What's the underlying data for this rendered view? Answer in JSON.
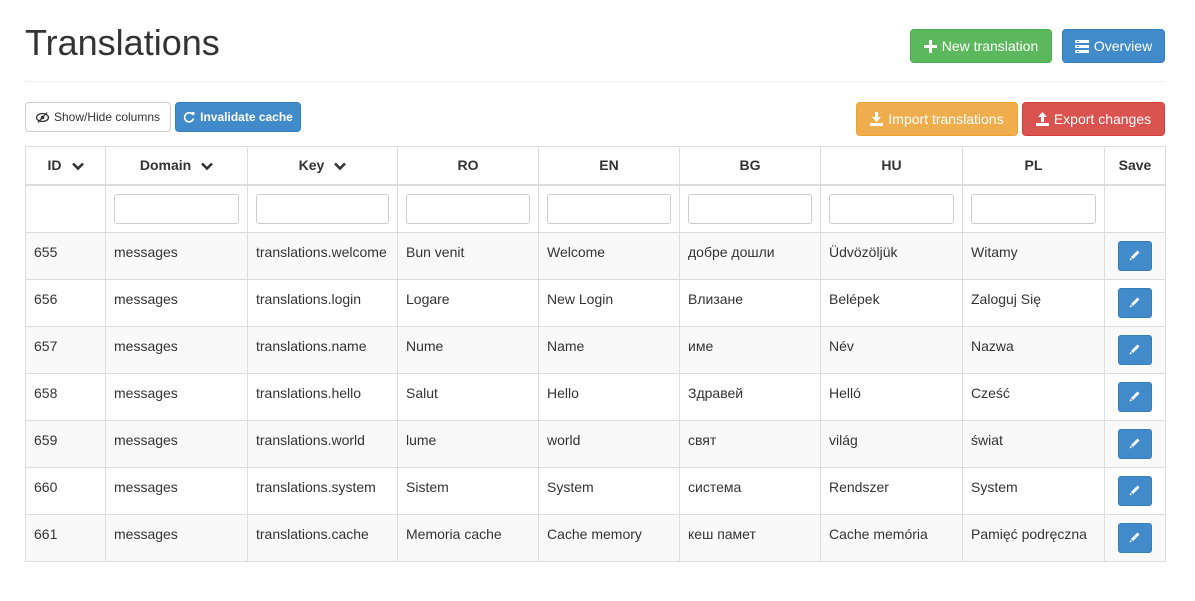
{
  "header": {
    "title": "Translations",
    "new_translation_label": "New translation",
    "overview_label": "Overview"
  },
  "toolbar": {
    "show_hide_columns_label": "Show/Hide columns",
    "invalidate_cache_label": "Invalidate cache",
    "import_label": "Import translations",
    "export_label": "Export changes"
  },
  "table": {
    "columns": [
      "ID",
      "Domain",
      "Key",
      "RO",
      "EN",
      "BG",
      "HU",
      "PL",
      "Save"
    ],
    "sortable_columns": [
      "ID",
      "Domain",
      "Key"
    ],
    "filters": {
      "domain": "",
      "key": "",
      "ro": "",
      "en": "",
      "bg": "",
      "hu": "",
      "pl": ""
    },
    "rows": [
      {
        "id": "655",
        "domain": "messages",
        "key": "translations.welcome",
        "ro": "Bun venit",
        "en": "Welcome",
        "bg": "добре дошли",
        "hu": "Üdvözöljük",
        "pl": "Witamy"
      },
      {
        "id": "656",
        "domain": "messages",
        "key": "translations.login",
        "ro": "Logare",
        "en": "New Login",
        "bg": "Влизане",
        "hu": "Belépek",
        "pl": "Zaloguj Się"
      },
      {
        "id": "657",
        "domain": "messages",
        "key": "translations.name",
        "ro": "Nume",
        "en": "Name",
        "bg": "име",
        "hu": "Név",
        "pl": "Nazwa"
      },
      {
        "id": "658",
        "domain": "messages",
        "key": "translations.hello",
        "ro": "Salut",
        "en": "Hello",
        "bg": "Здравей",
        "hu": "Helló",
        "pl": "Cześć"
      },
      {
        "id": "659",
        "domain": "messages",
        "key": "translations.world",
        "ro": "lume",
        "en": "world",
        "bg": "свят",
        "hu": "világ",
        "pl": "świat"
      },
      {
        "id": "660",
        "domain": "messages",
        "key": "translations.system",
        "ro": "Sistem",
        "en": "System",
        "bg": "система",
        "hu": "Rendszer",
        "pl": "System"
      },
      {
        "id": "661",
        "domain": "messages",
        "key": "translations.cache",
        "ro": "Memoria cache",
        "en": "Cache memory",
        "bg": "кеш памет",
        "hu": "Cache memória",
        "pl": "Pamięć podręczna"
      }
    ]
  },
  "icons": {
    "new_translation": "plus-icon",
    "overview": "list-icon",
    "show_hide": "eye-slash-icon",
    "invalidate": "refresh-icon",
    "import": "import-icon",
    "export": "export-icon",
    "sort": "chevron-down-icon",
    "edit": "pencil-icon"
  },
  "colors": {
    "success": "#5cb85c",
    "primary": "#428bca",
    "warning": "#f0ad4e",
    "danger": "#d9534f"
  }
}
